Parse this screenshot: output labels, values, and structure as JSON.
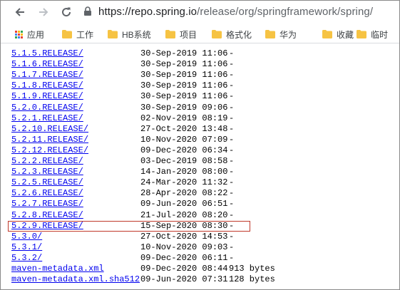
{
  "browser": {
    "url_host": "https://repo.spring.io",
    "url_path": "/release/org/springframework/spring/"
  },
  "bookmarks": [
    {
      "label": "应用",
      "icon": "apps-grid-icon"
    },
    {
      "label": "工作",
      "icon": "folder-icon"
    },
    {
      "label": "HB系统",
      "icon": "folder-icon"
    },
    {
      "label": "项目",
      "icon": "folder-icon"
    },
    {
      "label": "格式化",
      "icon": "folder-icon"
    },
    {
      "label": "华为",
      "icon": "folder-icon"
    },
    {
      "label": "收藏",
      "icon": "folder-icon"
    },
    {
      "label": "临时",
      "icon": "folder-icon"
    }
  ],
  "listing": [
    {
      "name": "5.1.5.RELEASE/",
      "date": "30-Sep-2019 11:06",
      "size": "-"
    },
    {
      "name": "5.1.6.RELEASE/",
      "date": "30-Sep-2019 11:06",
      "size": "-"
    },
    {
      "name": "5.1.7.RELEASE/",
      "date": "30-Sep-2019 11:06",
      "size": "-"
    },
    {
      "name": "5.1.8.RELEASE/",
      "date": "30-Sep-2019 11:06",
      "size": "-"
    },
    {
      "name": "5.1.9.RELEASE/",
      "date": "30-Sep-2019 11:06",
      "size": "-"
    },
    {
      "name": "5.2.0.RELEASE/",
      "date": "30-Sep-2019 09:06",
      "size": "-"
    },
    {
      "name": "5.2.1.RELEASE/",
      "date": "02-Nov-2019 08:19",
      "size": "-"
    },
    {
      "name": "5.2.10.RELEASE/",
      "date": "27-Oct-2020 13:48",
      "size": "-"
    },
    {
      "name": "5.2.11.RELEASE/",
      "date": "10-Nov-2020 07:09",
      "size": "-"
    },
    {
      "name": "5.2.12.RELEASE/",
      "date": "09-Dec-2020 06:34",
      "size": "-"
    },
    {
      "name": "5.2.2.RELEASE/",
      "date": "03-Dec-2019 08:58",
      "size": "-"
    },
    {
      "name": "5.2.3.RELEASE/",
      "date": "14-Jan-2020 08:00",
      "size": "-"
    },
    {
      "name": "5.2.5.RELEASE/",
      "date": "24-Mar-2020 11:32",
      "size": "-"
    },
    {
      "name": "5.2.6.RELEASE/",
      "date": "28-Apr-2020 08:22",
      "size": "-"
    },
    {
      "name": "5.2.7.RELEASE/",
      "date": "09-Jun-2020 06:51",
      "size": "-"
    },
    {
      "name": "5.2.8.RELEASE/",
      "date": "21-Jul-2020 08:20",
      "size": "-"
    },
    {
      "name": "5.2.9.RELEASE/",
      "date": "15-Sep-2020 08:30",
      "size": "-",
      "highlighted": true
    },
    {
      "name": "5.3.0/",
      "date": "27-Oct-2020 14:53",
      "size": "-"
    },
    {
      "name": "5.3.1/",
      "date": "10-Nov-2020 09:03",
      "size": "-"
    },
    {
      "name": "5.3.2/",
      "date": "09-Dec-2020 06:11",
      "size": "-"
    },
    {
      "name": "maven-metadata.xml",
      "date": "09-Dec-2020 08:44",
      "size": "913 bytes"
    },
    {
      "name": "maven-metadata.xml.sha512",
      "date": "09-Jun-2020 07:31",
      "size": "128 bytes"
    }
  ],
  "colors": {
    "link": "#0000ee",
    "highlight_border": "#c0392b",
    "folder": "#f6c343"
  }
}
